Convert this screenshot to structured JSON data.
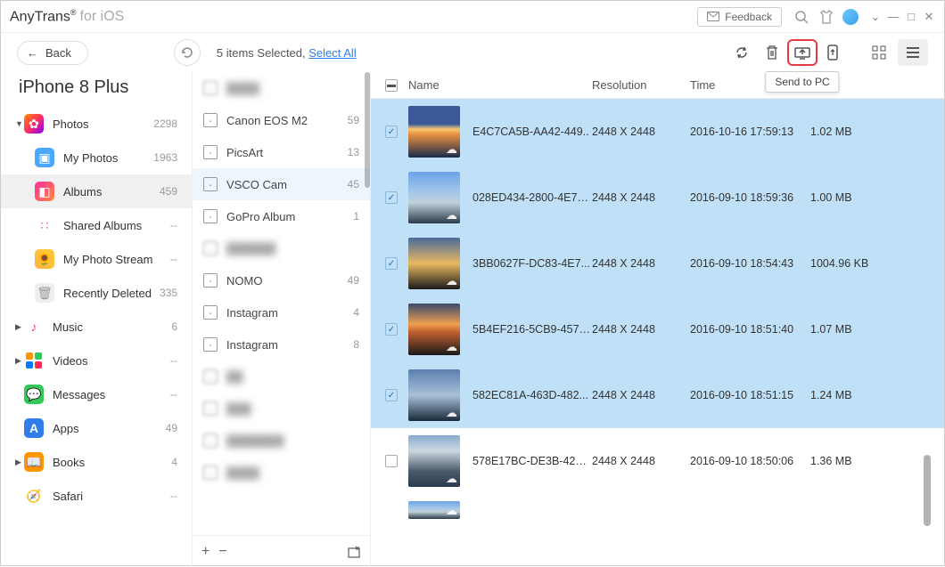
{
  "app": {
    "name": "AnyTrans",
    "suffix": "for iOS"
  },
  "titlebar": {
    "feedback": "Feedback"
  },
  "toolbar": {
    "back": "Back",
    "selection_text": "5 items Selected, ",
    "select_all": "Select All",
    "tooltip_send_pc": "Send to PC"
  },
  "device": {
    "name": "iPhone 8 Plus"
  },
  "sidebar": [
    {
      "label": "Photos",
      "count": "2298",
      "expandable": true
    },
    {
      "label": "My Photos",
      "count": "1963",
      "sub": true
    },
    {
      "label": "Albums",
      "count": "459",
      "sub": true,
      "selected": true
    },
    {
      "label": "Shared Albums",
      "count": "--",
      "sub": true
    },
    {
      "label": "My Photo Stream",
      "count": "--",
      "sub": true
    },
    {
      "label": "Recently Deleted",
      "count": "335",
      "sub": true
    },
    {
      "label": "Music",
      "count": "6",
      "expandable": true
    },
    {
      "label": "Videos",
      "count": "--",
      "expandable": true
    },
    {
      "label": "Messages",
      "count": "--"
    },
    {
      "label": "Apps",
      "count": "49"
    },
    {
      "label": "Books",
      "count": "4",
      "expandable": true
    },
    {
      "label": "Safari",
      "count": "--"
    }
  ],
  "albums": [
    {
      "label": "Canon EOS M2",
      "count": "59"
    },
    {
      "label": "PicsArt",
      "count": "13"
    },
    {
      "label": "VSCO Cam",
      "count": "45",
      "selected": true
    },
    {
      "label": "GoPro Album",
      "count": "1"
    },
    {
      "label": "NOMO",
      "count": "49"
    },
    {
      "label": "Instagram",
      "count": "4"
    },
    {
      "label": "Instagram",
      "count": "8"
    }
  ],
  "columns": {
    "name": "Name",
    "resolution": "Resolution",
    "time": "Time",
    "size": ""
  },
  "rows": [
    {
      "name": "E4C7CA5B-AA42-449..",
      "res": "2448 X 2448",
      "time": "2016-10-16 17:59:13",
      "size": "1.02 MB",
      "sel": true,
      "thumb": ""
    },
    {
      "name": "028ED434-2800-4E78...",
      "res": "2448 X 2448",
      "time": "2016-09-10 18:59:36",
      "size": "1.00 MB",
      "sel": true,
      "thumb": "t2"
    },
    {
      "name": "3BB0627F-DC83-4E7...",
      "res": "2448 X 2448",
      "time": "2016-09-10 18:54:43",
      "size": "1004.96 KB",
      "sel": true,
      "thumb": "t3"
    },
    {
      "name": "5B4EF216-5CB9-4574...",
      "res": "2448 X 2448",
      "time": "2016-09-10 18:51:40",
      "size": "1.07 MB",
      "sel": true,
      "thumb": "t4"
    },
    {
      "name": "582EC81A-463D-482...",
      "res": "2448 X 2448",
      "time": "2016-09-10 18:51:15",
      "size": "1.24 MB",
      "sel": true,
      "thumb": "t5"
    },
    {
      "name": "578E17BC-DE3B-42B...",
      "res": "2448 X 2448",
      "time": "2016-09-10 18:50:06",
      "size": "1.36 MB",
      "sel": false,
      "thumb": "t6"
    }
  ]
}
